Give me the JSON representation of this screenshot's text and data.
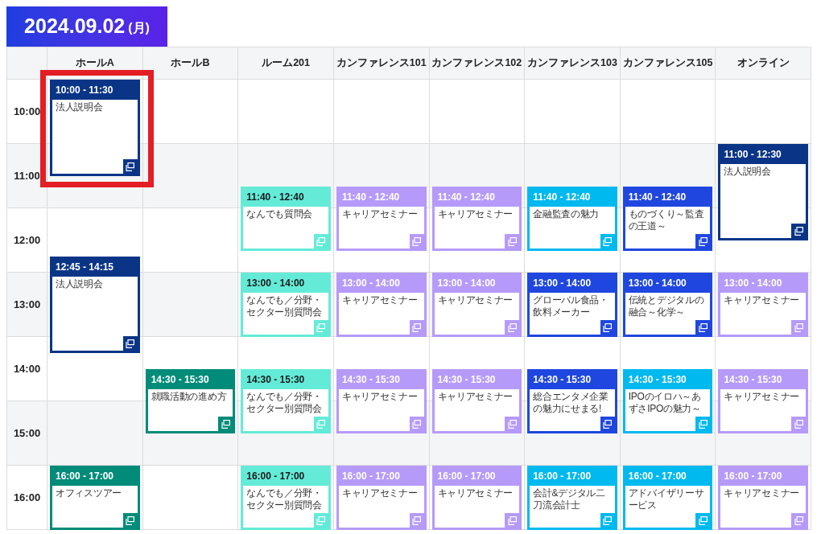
{
  "date": {
    "day": "2024.09.02",
    "weekday": "(月)"
  },
  "times": [
    "10:00",
    "11:00",
    "12:00",
    "13:00",
    "14:00",
    "15:00",
    "16:00"
  ],
  "rooms": [
    {
      "name": "ホールA",
      "events": [
        {
          "time": "10:00 - 11:30",
          "title": "法人説明会",
          "color": "#0a3587",
          "highlighted": true
        },
        {
          "time": "12:45 - 14:15",
          "title": "法人説明会",
          "color": "#0a3587",
          "highlighted": false
        },
        {
          "time": "16:00 - 17:00",
          "title": "オフィスツアー",
          "color": "#008c79",
          "highlighted": false
        }
      ]
    },
    {
      "name": "ホールB",
      "events": [
        {
          "time": "14:30 - 15:30",
          "title": "就職活動の進め方",
          "color": "#008c79",
          "highlighted": false
        }
      ]
    },
    {
      "name": "ルーム201",
      "events": [
        {
          "time": "11:40 - 12:40",
          "title": "なんでも質問会",
          "color": "#63ebd8",
          "highlighted": false
        },
        {
          "time": "13:00 - 14:00",
          "title": "なんでも／分野・セクター別質問会",
          "color": "#63ebd8",
          "highlighted": false
        },
        {
          "time": "14:30 - 15:30",
          "title": "なんでも／分野・セクター別質問会",
          "color": "#63ebd8",
          "highlighted": false
        },
        {
          "time": "16:00 - 17:00",
          "title": "なんでも／分野・セクター別質問会",
          "color": "#63ebd8",
          "highlighted": false
        }
      ]
    },
    {
      "name": "カンファレンス101",
      "events": [
        {
          "time": "11:40 - 12:40",
          "title": "キャリアセミナー",
          "color": "#b69afa",
          "highlighted": false
        },
        {
          "time": "13:00 - 14:00",
          "title": "キャリアセミナー",
          "color": "#b69afa",
          "highlighted": false
        },
        {
          "time": "14:30 - 15:30",
          "title": "キャリアセミナー",
          "color": "#b69afa",
          "highlighted": false
        },
        {
          "time": "16:00 - 17:00",
          "title": "キャリアセミナー",
          "color": "#b69afa",
          "highlighted": false
        }
      ]
    },
    {
      "name": "カンファレンス102",
      "events": [
        {
          "time": "11:40 - 12:40",
          "title": "キャリアセミナー",
          "color": "#b69afa",
          "highlighted": false
        },
        {
          "time": "13:00 - 14:00",
          "title": "キャリアセミナー",
          "color": "#b69afa",
          "highlighted": false
        },
        {
          "time": "14:30 - 15:30",
          "title": "キャリアセミナー",
          "color": "#b69afa",
          "highlighted": false
        },
        {
          "time": "16:00 - 17:00",
          "title": "キャリアセミナー",
          "color": "#b69afa",
          "highlighted": false
        }
      ]
    },
    {
      "name": "カンファレンス103",
      "events": [
        {
          "time": "11:40 - 12:40",
          "title": "金融監査の魅力",
          "color": "#00b9ef",
          "highlighted": false
        },
        {
          "time": "13:00 - 14:00",
          "title": "グローバル食品・飲料メーカー",
          "color": "#1f47e0",
          "highlighted": false
        },
        {
          "time": "14:30 - 15:30",
          "title": "総合エンタメ企業の魅力にせまる!",
          "color": "#1f47e0",
          "highlighted": false
        },
        {
          "time": "16:00 - 17:00",
          "title": "会計&デジタル二刀流会計士",
          "color": "#00b9ef",
          "highlighted": false
        }
      ]
    },
    {
      "name": "カンファレンス105",
      "events": [
        {
          "time": "11:40 - 12:40",
          "title": "ものづくり～監査の王道～",
          "color": "#1f47e0",
          "highlighted": false
        },
        {
          "time": "13:00 - 14:00",
          "title": "伝統とデジタルの融合～化学～",
          "color": "#1f47e0",
          "highlighted": false
        },
        {
          "time": "14:30 - 15:30",
          "title": "IPOのイロハ～あずさIPOの魅力～",
          "color": "#00b9ef",
          "highlighted": false
        },
        {
          "time": "16:00 - 17:00",
          "title": "アドバイザリーサービス",
          "color": "#00b9ef",
          "highlighted": false
        }
      ]
    },
    {
      "name": "オンライン",
      "events": [
        {
          "time": "11:00 - 12:30",
          "title": "法人説明会",
          "color": "#0a3587",
          "highlighted": false
        },
        {
          "time": "13:00 - 14:00",
          "title": "キャリアセミナー",
          "color": "#b69afa",
          "highlighted": false
        },
        {
          "time": "14:30 - 15:30",
          "title": "キャリアセミナー",
          "color": "#b69afa",
          "highlighted": false
        },
        {
          "time": "16:00 - 17:00",
          "title": "キャリアセミナー",
          "color": "#b69afa",
          "highlighted": false
        }
      ]
    }
  ]
}
